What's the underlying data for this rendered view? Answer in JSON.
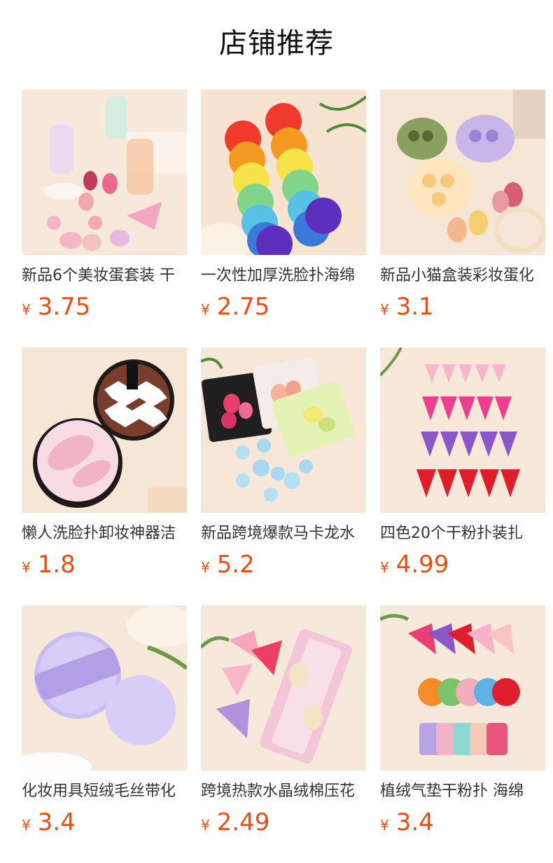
{
  "header": {
    "title": "店铺推荐"
  },
  "currency_symbol": "¥",
  "products": [
    {
      "title": "新品6个美妆蛋套装 干",
      "price": "3.75",
      "image_icon": "makeup-egg-set-icon"
    },
    {
      "title": "一次性加厚洗脸扑海绵",
      "price": "2.75",
      "image_icon": "rainbow-sponge-icon"
    },
    {
      "title": "新品小猫盒装彩妆蛋化",
      "price": "3.1",
      "image_icon": "cat-box-egg-icon"
    },
    {
      "title": "懒人洗脸扑卸妆神器洁",
      "price": "1.8",
      "image_icon": "face-wash-puff-icon"
    },
    {
      "title": "新品跨境爆款马卡龙水",
      "price": "5.2",
      "image_icon": "macaron-puff-bag-icon"
    },
    {
      "title": "四色20个干粉扑装扎",
      "price": "4.99",
      "image_icon": "triangle-puff-icon"
    },
    {
      "title": "化妆用具短绒毛丝带化",
      "price": "3.4",
      "image_icon": "velvet-puff-icon"
    },
    {
      "title": "跨境热款水晶绒棉压花",
      "price": "2.49",
      "image_icon": "crystal-puff-icon"
    },
    {
      "title": "植绒气垫干粉扑 海绵",
      "price": "3.4",
      "image_icon": "flocked-puff-icon"
    }
  ],
  "colors": {
    "price": "#e94e14",
    "background": "#ffffff",
    "thumb_bg": "#f6e7d8"
  }
}
